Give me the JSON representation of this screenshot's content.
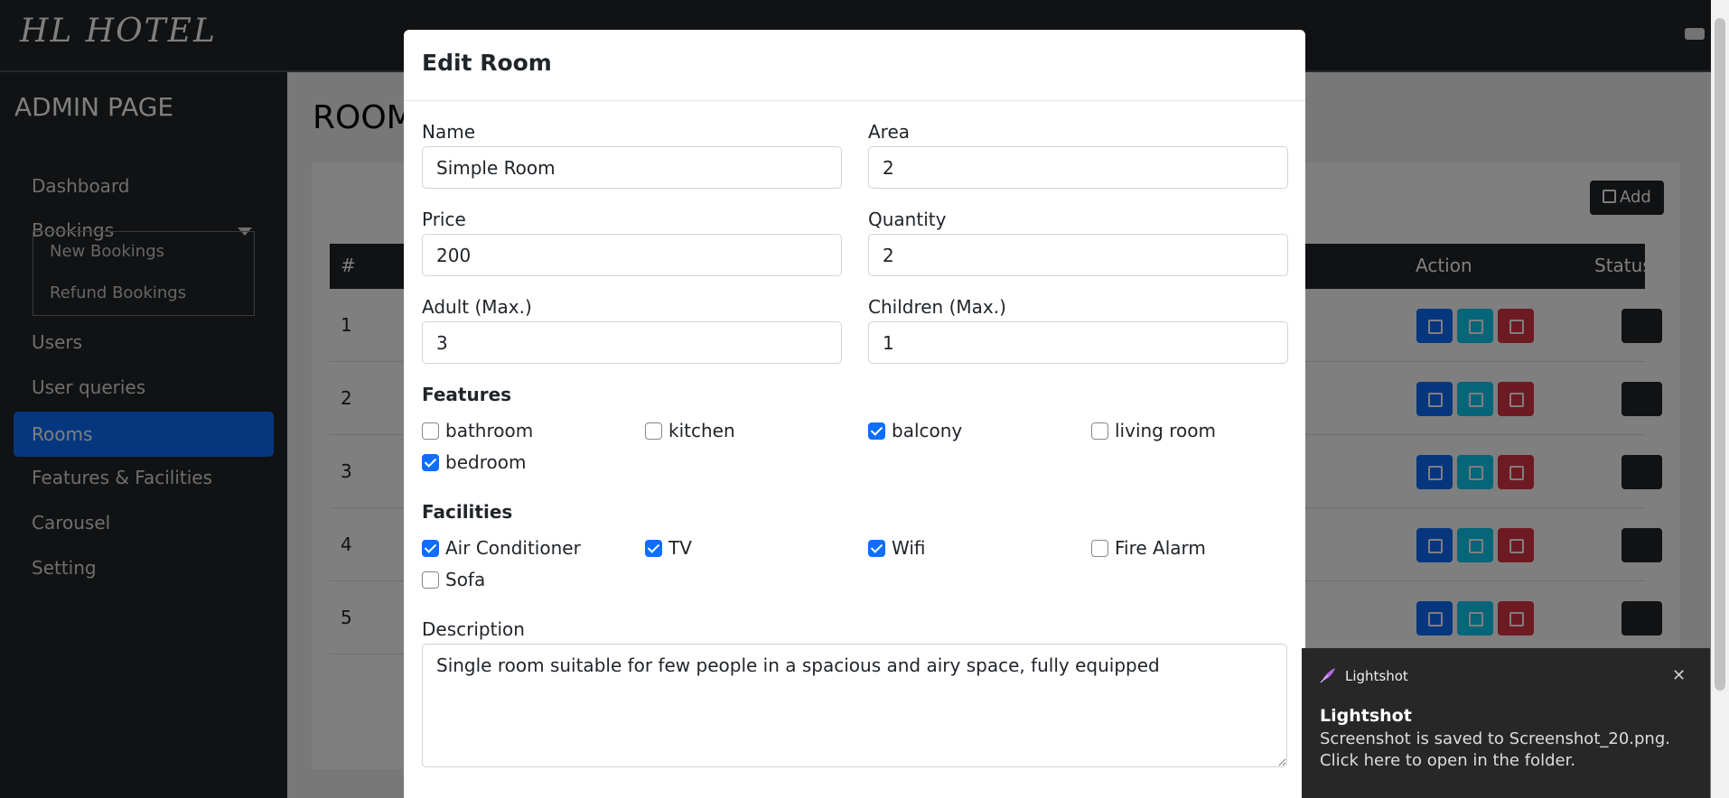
{
  "brand": "HL HOTEL",
  "sidebar": {
    "title": "ADMIN PAGE",
    "items": [
      "Dashboard",
      "Bookings",
      "Users",
      "User queries",
      "Rooms",
      "Features & Facilities",
      "Carousel",
      "Setting"
    ],
    "bookings_sub": [
      "New Bookings",
      "Refund Bookings"
    ],
    "active": "Rooms"
  },
  "page": {
    "title": "ROOMS",
    "add_label": "Add",
    "columns": {
      "num": "#",
      "status": "Status",
      "action": "Action"
    },
    "row_numbers": [
      "1",
      "2",
      "3",
      "4",
      "5"
    ]
  },
  "modal": {
    "title": "Edit Room",
    "name_label": "Name",
    "name_value": "Simple Room",
    "area_label": "Area",
    "area_value": "2",
    "price_label": "Price",
    "price_value": "200",
    "quantity_label": "Quantity",
    "quantity_value": "2",
    "adult_label": "Adult (Max.)",
    "adult_value": "3",
    "children_label": "Children (Max.)",
    "children_value": "1",
    "features_title": "Features",
    "features": [
      {
        "label": "bathroom",
        "checked": false
      },
      {
        "label": "kitchen",
        "checked": false
      },
      {
        "label": "balcony",
        "checked": true
      },
      {
        "label": "living room",
        "checked": false
      },
      {
        "label": "bedroom",
        "checked": true
      }
    ],
    "facilities_title": "Facilities",
    "facilities": [
      {
        "label": "Air Conditioner",
        "checked": true
      },
      {
        "label": "TV",
        "checked": true
      },
      {
        "label": "Wifi",
        "checked": true
      },
      {
        "label": "Fire Alarm",
        "checked": false
      },
      {
        "label": "Sofa",
        "checked": false
      }
    ],
    "description_label": "Description",
    "description_value": "Single room suitable for few people in a spacious and airy space, fully equipped"
  },
  "toast": {
    "app": "Lightshot",
    "title": "Lightshot",
    "message": "Screenshot is saved to Screenshot_20.png. Click here to open in the folder.",
    "close": "✕"
  },
  "colors": {
    "primary": "#0d6efd",
    "dark": "#212529",
    "info": "#0dcaf0",
    "danger": "#dc3545"
  }
}
